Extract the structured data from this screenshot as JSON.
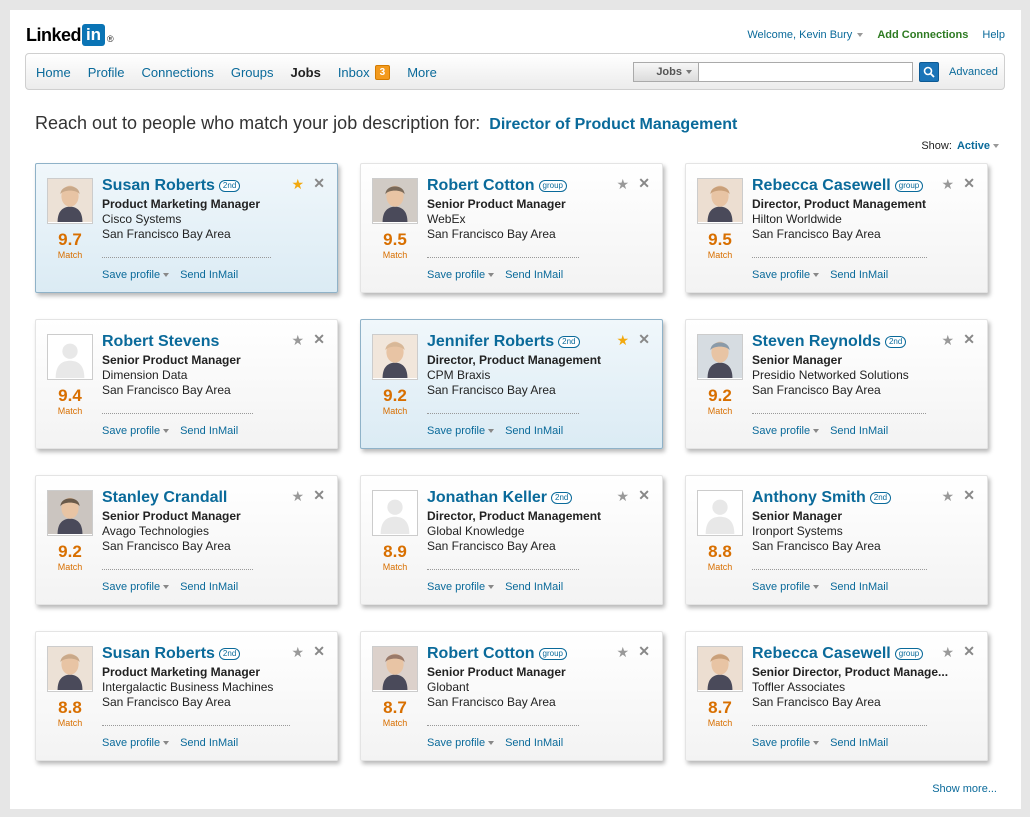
{
  "header": {
    "logo_text": "Linked",
    "logo_in": "in",
    "logo_reg": "®",
    "welcome": "Welcome, Kevin Bury",
    "add_connections": "Add Connections",
    "help": "Help"
  },
  "nav": {
    "items": [
      {
        "label": "Home"
      },
      {
        "label": "Profile"
      },
      {
        "label": "Connections"
      },
      {
        "label": "Groups"
      },
      {
        "label": "Jobs"
      },
      {
        "label": "Inbox"
      },
      {
        "label": "More"
      }
    ],
    "inbox_count": "3"
  },
  "search": {
    "scope": "Jobs",
    "query": "",
    "advanced": "Advanced"
  },
  "headline": {
    "text": "Reach out to people who match your job description for:",
    "job": "Director of Product Management"
  },
  "filter": {
    "label": "Show:",
    "value": "Active"
  },
  "card_actions": {
    "save": "Save profile",
    "inmail": "Send InMail",
    "match": "Match"
  },
  "colors": {
    "link": "#0a6a9a",
    "score": "#d86f00",
    "star_active": "#f2a90f",
    "selected_bg": "#dbebf4"
  },
  "candidates": [
    {
      "name": "Susan Roberts",
      "degree": "2nd",
      "title": "Product Marketing Manager",
      "company": "Cisco Systems",
      "location": "San Francisco Bay Area",
      "score": "9.7",
      "starred": true,
      "selected": true
    },
    {
      "name": "Robert Cotton",
      "degree": "group",
      "title": "Senior Product Manager",
      "company": "WebEx",
      "location": "San Francisco Bay Area",
      "score": "9.5",
      "starred": false,
      "selected": false
    },
    {
      "name": "Rebecca Casewell",
      "degree": "group",
      "title": "Director, Product Management",
      "company": "Hilton Worldwide",
      "location": "San Francisco Bay Area",
      "score": "9.5",
      "starred": false,
      "selected": false
    },
    {
      "name": "Robert Stevens",
      "degree": "",
      "title": "Senior Product Manager",
      "company": "Dimension Data",
      "location": "San Francisco Bay Area",
      "score": "9.4",
      "starred": false,
      "selected": false
    },
    {
      "name": "Jennifer Roberts",
      "degree": "2nd",
      "title": "Director, Product Management",
      "company": "CPM Braxis",
      "location": "San Francisco Bay Area",
      "score": "9.2",
      "starred": true,
      "selected": true
    },
    {
      "name": "Steven Reynolds",
      "degree": "2nd",
      "title": "Senior Manager",
      "company": "Presidio Networked Solutions",
      "location": "San Francisco Bay Area",
      "score": "9.2",
      "starred": false,
      "selected": false
    },
    {
      "name": "Stanley Crandall",
      "degree": "",
      "title": "Senior Product Manager",
      "company": "Avago Technologies",
      "location": "San Francisco Bay Area",
      "score": "9.2",
      "starred": false,
      "selected": false
    },
    {
      "name": "Jonathan Keller",
      "degree": "2nd",
      "title": "Director, Product Management",
      "company": "Global Knowledge",
      "location": "San Francisco Bay Area",
      "score": "8.9",
      "starred": false,
      "selected": false
    },
    {
      "name": "Anthony Smith",
      "degree": "2nd",
      "title": "Senior Manager",
      "company": "Ironport Systems",
      "location": "San Francisco Bay Area",
      "score": "8.8",
      "starred": false,
      "selected": false
    },
    {
      "name": "Susan Roberts",
      "degree": "2nd",
      "title": "Product Marketing Manager",
      "company": "Intergalactic Business Machines",
      "location": "San Francisco Bay Area",
      "score": "8.8",
      "starred": false,
      "selected": false
    },
    {
      "name": "Robert Cotton",
      "degree": "group",
      "title": "Senior Product Manager",
      "company": "Globant",
      "location": "San Francisco Bay Area",
      "score": "8.7",
      "starred": false,
      "selected": false
    },
    {
      "name": "Rebecca Casewell",
      "degree": "group",
      "title": "Senior Director, Product Manage...",
      "company": "Toffler Associates",
      "location": "San Francisco Bay Area",
      "score": "8.7",
      "starred": false,
      "selected": false
    }
  ],
  "show_more": "Show more..."
}
